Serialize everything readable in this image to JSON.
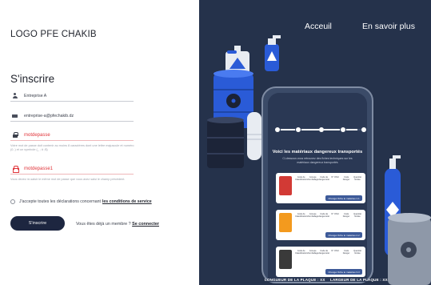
{
  "form": {
    "logo": "LOGO PFE CHAKIB",
    "title": "S'inscrire",
    "company_value": "Entreprise A",
    "email_value": "entreprise-a@pfechakib.dz",
    "password_value": "motdepasse",
    "password_hint": "Votre mot de passe doit contenir au moins 8 caractères dont une lettre majuscule et numéro (0..) et un symbole (_ ; # ;$)",
    "confirm_value": "motdepasse1",
    "confirm_hint": "Vous devez re-saisir le même mot de passe que vous avez saisi le champ précédent.",
    "accept_text": "J'accepte toutes les déclarations concernant",
    "accept_link": "les conditions de service",
    "submit_label": "S'inscrire",
    "member_text": "Vous êtes déjà un membre ?",
    "login_link": "Se connecter",
    "colors": {
      "error": "#e0343a",
      "button": "#1d2640"
    }
  },
  "hero": {
    "nav_home": "Acceuil",
    "nav_more": "En savoir plus",
    "screen_title": "Voici les matériaux dangereux transportés",
    "screen_subtitle": "Ci-dessous vous retrouvez des fiches techniques sur les matériaux dangereux transportés",
    "card_columns": [
      "Code de Classification",
      "Groupe d'emballage",
      "Code de dangerosité",
      "N° ONU",
      "Code Danger",
      "Quantité limitée"
    ],
    "cards": [
      {
        "cta": "Changer fiche le matériau 1.1",
        "pic_color": "#d23a35"
      },
      {
        "cta": "Changer fiche le matériau 2.2",
        "pic_color": "#f39a1e"
      },
      {
        "cta": "Changer fiche le matériau 3.3",
        "pic_color": "#3a3a3a"
      }
    ],
    "length_label": "LONGUEUR DE LA PLAQUE : XX",
    "width_label": "LARGEUR DE LA PLAQUE : XX",
    "colors": {
      "background": "#25324b",
      "barrel_blue": "#2a5bd7",
      "phone": "#3b4b68"
    }
  }
}
